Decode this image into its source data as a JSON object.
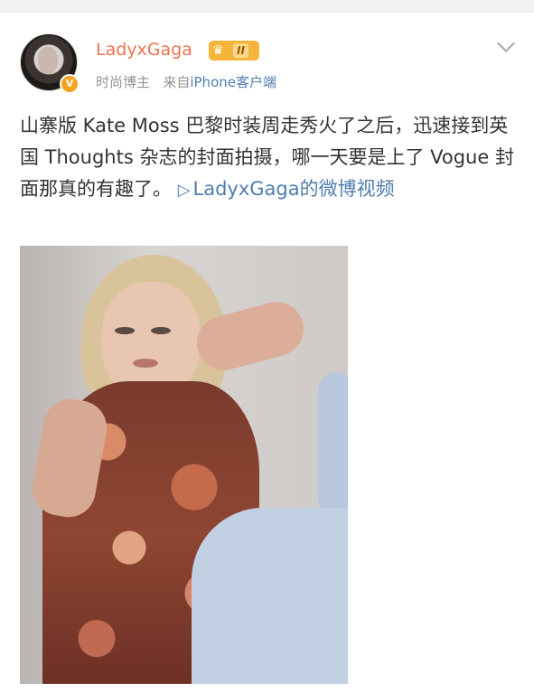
{
  "post": {
    "username": "LadyxGaga",
    "member_level": "II",
    "verified_badge": "V",
    "meta": {
      "role": "时尚博主",
      "source_prefix": "来自",
      "source_device": "iPhone客户端"
    },
    "text": {
      "body": "山寨版 Kate Moss 巴黎时装周走秀火了之后，迅速接到英国 Thoughts 杂志的封面拍摄，哪一天要是上了 Vogue 封面那真的有趣了。",
      "video_link": "LadyxGaga的微博视频"
    },
    "media": {
      "type": "photo",
      "subject": "woman-with-blond-hair-having-makeup"
    }
  },
  "colors": {
    "username": "#eb7350",
    "link": "#507daf",
    "body_text": "#333333",
    "meta_text": "#939393",
    "crown_badge": "#f5b43a",
    "verified_badge": "#f7a21d"
  },
  "icons": [
    "crown-icon",
    "verified-icon",
    "chevron-down-icon",
    "video-play-icon"
  ]
}
